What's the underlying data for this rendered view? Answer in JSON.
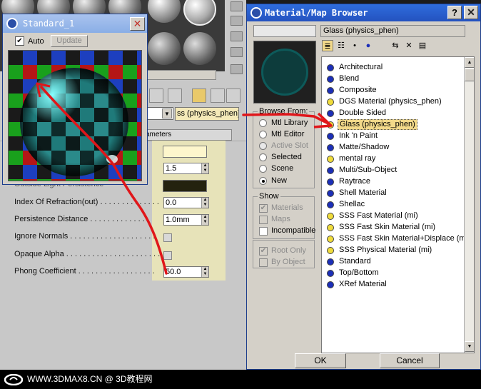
{
  "colors": {
    "title_blue": "#2452bf",
    "title_faded": "#8aaee6",
    "selection_yellow": "#f2d98a",
    "annotation_red": "#e0161a",
    "dot_blue": "#1c2fb8",
    "dot_yellow": "#f0dc3c"
  },
  "standard_window": {
    "title": "Standard_1",
    "auto_label": "Auto",
    "auto_checked": true,
    "update_label": "Update"
  },
  "background_editor": {
    "material_dropdown_text": "ss (physics_phen)",
    "rollout_title": "ameters",
    "params": [
      {
        "label": "Outside Light Persistence",
        "control": "color"
      },
      {
        "label": "Index Of Refraction(out) . . . . . . . . . . . . . .",
        "value": "0.0",
        "control": "spinner"
      },
      {
        "label": "Persistence Distance . . . . . . . . . . . . . .",
        "value": "1.0mm",
        "control": "spinner"
      },
      {
        "label": "Ignore Normals . . . . . . . . . . . . . . . . . . . .",
        "control": "checkbox"
      },
      {
        "label": "Opaque Alpha . . . . . . . . . . . . . . . . . . . . . .",
        "control": "checkbox"
      },
      {
        "label": "Phong Coefficient . . . . . . . . . . . . . . . . . .",
        "value": "50.0",
        "control": "spinner"
      }
    ],
    "upper_spinner_value": "1.5"
  },
  "browser": {
    "title": "Material/Map Browser",
    "help_label": "?",
    "close_label": "✕",
    "current_name": "Glass (physics_phen)",
    "browse_from": {
      "label": "Browse From:",
      "options": [
        {
          "label": "Mtl Library",
          "selected": false,
          "disabled": false
        },
        {
          "label": "Mtl Editor",
          "selected": false,
          "disabled": false
        },
        {
          "label": "Active Slot",
          "selected": false,
          "disabled": true
        },
        {
          "label": "Selected",
          "selected": false,
          "disabled": false
        },
        {
          "label": "Scene",
          "selected": false,
          "disabled": false
        },
        {
          "label": "New",
          "selected": true,
          "disabled": false
        }
      ]
    },
    "show": {
      "label": "Show",
      "options": [
        {
          "label": "Materials",
          "checked": true,
          "disabled": true
        },
        {
          "label": "Maps",
          "checked": false,
          "disabled": true
        },
        {
          "label": "Incompatible",
          "checked": false,
          "disabled": false
        }
      ]
    },
    "root_options": [
      {
        "label": "Root Only",
        "checked": true,
        "disabled": true
      },
      {
        "label": "By Object",
        "checked": false,
        "disabled": true
      }
    ],
    "materials": [
      {
        "label": "Architectural",
        "dot": "blue"
      },
      {
        "label": "Blend",
        "dot": "blue"
      },
      {
        "label": "Composite",
        "dot": "blue"
      },
      {
        "label": "DGS Material (physics_phen)",
        "dot": "yellow"
      },
      {
        "label": "Double Sided",
        "dot": "blue"
      },
      {
        "label": "Glass (physics_phen)",
        "dot": "yellow",
        "selected": true
      },
      {
        "label": "Ink 'n Paint",
        "dot": "blue"
      },
      {
        "label": "Matte/Shadow",
        "dot": "blue"
      },
      {
        "label": "mental ray",
        "dot": "yellow"
      },
      {
        "label": "Multi/Sub-Object",
        "dot": "blue"
      },
      {
        "label": "Raytrace",
        "dot": "blue"
      },
      {
        "label": "Shell Material",
        "dot": "blue"
      },
      {
        "label": "Shellac",
        "dot": "blue"
      },
      {
        "label": "SSS Fast Material (mi)",
        "dot": "yellow"
      },
      {
        "label": "SSS Fast Skin Material (mi)",
        "dot": "yellow"
      },
      {
        "label": "SSS Fast Skin Material+Displace (mi)",
        "dot": "yellow"
      },
      {
        "label": "SSS Physical Material (mi)",
        "dot": "yellow"
      },
      {
        "label": "Standard",
        "dot": "blue"
      },
      {
        "label": "Top/Bottom",
        "dot": "blue"
      },
      {
        "label": "XRef Material",
        "dot": "blue"
      }
    ],
    "ok_label": "OK",
    "cancel_label": "Cancel"
  },
  "watermark": {
    "text": "WWW.3DMAX8.CN @ 3D教程网"
  }
}
